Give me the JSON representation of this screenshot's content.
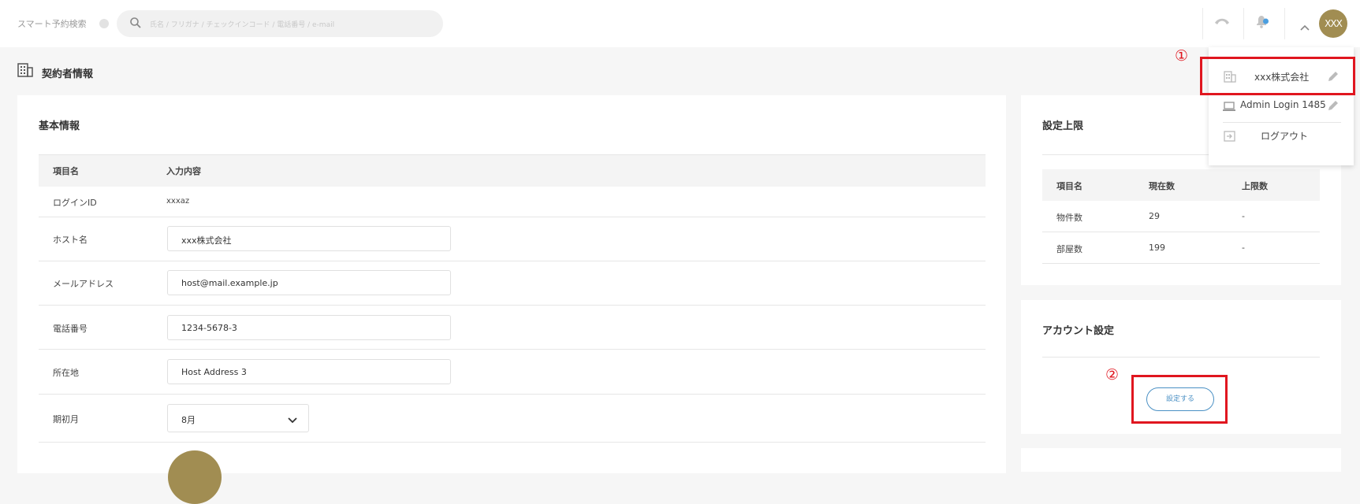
{
  "topbar": {
    "smart_search_label": "スマート予約検索",
    "search_placeholder": "氏名 / フリガナ / チェックインコード / 電話番号 / e-mail",
    "avatar_text": "XXX"
  },
  "page": {
    "title": "契約者情報"
  },
  "basic_info": {
    "title": "基本情報",
    "header_item": "項目名",
    "header_content": "入力内容",
    "login_id_label": "ログインID",
    "login_id_value": "xxxaz",
    "host_name_label": "ホスト名",
    "host_name_value": "xxx株式会社",
    "email_label": "メールアドレス",
    "email_value": "host@mail.example.jp",
    "phone_label": "電話番号",
    "phone_value": "1234-5678-3",
    "address_label": "所在地",
    "address_value": "Host Address 3",
    "fiscal_month_label": "期初月",
    "fiscal_month_value": "8月"
  },
  "limits": {
    "title": "設定上限",
    "header_item": "項目名",
    "header_current": "現在数",
    "header_limit": "上限数",
    "rows": [
      {
        "name": "物件数",
        "current": "29",
        "limit": "-"
      },
      {
        "name": "部屋数",
        "current": "199",
        "limit": "-"
      }
    ]
  },
  "account": {
    "title": "アカウント設定",
    "button_label": "設定する"
  },
  "dropdown": {
    "company_name": "xxx株式会社",
    "admin_login": "Admin Login 1485",
    "logout": "ログアウト"
  },
  "annotations": {
    "marker_1": "①",
    "marker_2": "②"
  },
  "colors": {
    "highlight_red": "#e0161f",
    "accent_blue": "#4a90c4",
    "avatar_gold": "#a18d52",
    "notification_blue": "#4a9ee0"
  },
  "icons": [
    "search-icon",
    "phone-hangup-icon",
    "bell-icon",
    "chevron-up-icon",
    "building-icon",
    "laptop-icon",
    "edit-pencil-icon",
    "logout-icon",
    "chevron-down-icon"
  ]
}
